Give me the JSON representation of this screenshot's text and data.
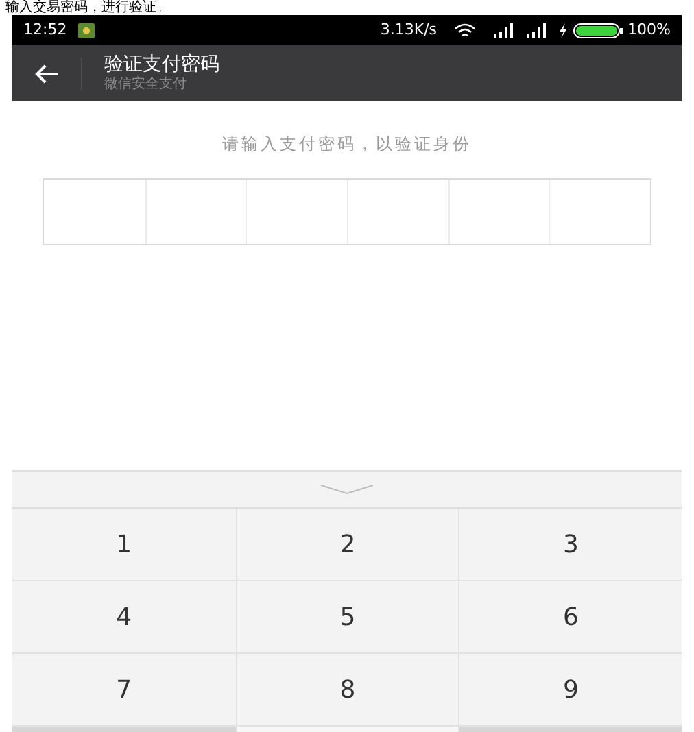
{
  "caption": "输入交易密码，进行验证。",
  "status_bar": {
    "time": "12:52",
    "speed": "3.13K/s",
    "battery": "100%"
  },
  "header": {
    "title": "验证支付密码",
    "subtitle": "微信安全支付"
  },
  "prompt": "请输入支付密码，以验证身份",
  "keypad": [
    "1",
    "2",
    "3",
    "4",
    "5",
    "6",
    "7",
    "8",
    "9"
  ]
}
